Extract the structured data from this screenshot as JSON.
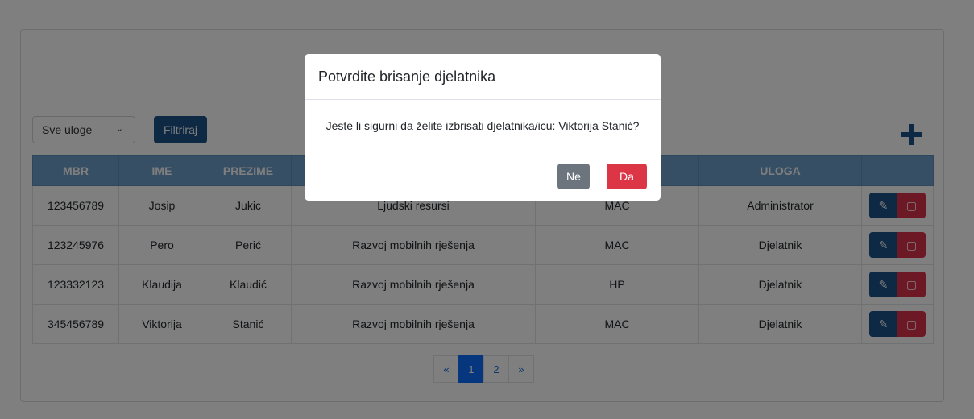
{
  "toolbar": {
    "role_select_value": "Sve uloge",
    "filter_label": "Filtriraj"
  },
  "table": {
    "headers": [
      "MBR",
      "IME",
      "PREZIME",
      "",
      "",
      "ULOGA",
      ""
    ],
    "rows": [
      [
        "123456789",
        "Josip",
        "Jukic",
        "Ljudski resursi",
        "MAC",
        "Administrator"
      ],
      [
        "123245976",
        "Pero",
        "Perić",
        "Razvoj mobilnih rješenja",
        "MAC",
        "Djelatnik"
      ],
      [
        "123332123",
        "Klaudija",
        "Klaudić",
        "Razvoj mobilnih rješenja",
        "HP",
        "Djelatnik"
      ],
      [
        "345456789",
        "Viktorija",
        "Stanić",
        "Razvoj mobilnih rješenja",
        "MAC",
        "Djelatnik"
      ]
    ]
  },
  "pagination": {
    "prev": "«",
    "pages": [
      "1",
      "2"
    ],
    "next": "»",
    "current": "1"
  },
  "modal": {
    "title": "Potvrdite brisanje djelatnika",
    "message": "Jeste li sigurni da želite izbrisati djelatnika/icu: Viktorija Stanić?",
    "no_label": "Ne",
    "yes_label": "Da"
  },
  "icons": {
    "add": "plus-icon",
    "edit": "edit-icon",
    "delete": "trash-icon",
    "dropdown": "chevron-down-icon"
  },
  "colors": {
    "primary": "#1b5388",
    "header": "#6f9ec8",
    "danger": "#dc3545",
    "secondary": "#6c757d",
    "active_page": "#0d6efd"
  }
}
